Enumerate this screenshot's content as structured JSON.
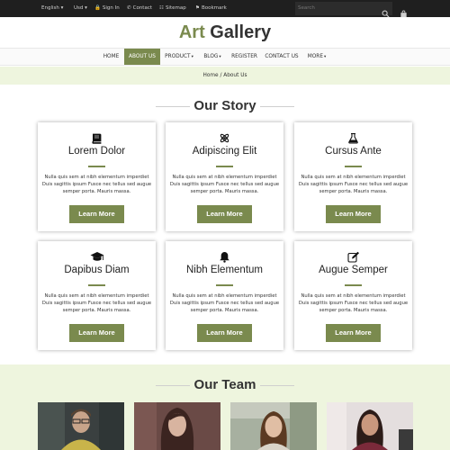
{
  "topbar": {
    "language": "English",
    "currency": "Usd",
    "signin": "Sign In",
    "contact": "Contact",
    "sitemap": "Sitemap",
    "bookmark": "Bookmark",
    "search_placeholder": "Search"
  },
  "brand": {
    "part1": "Art",
    "part2": " Gallery",
    "accent_color": "#7a8a4e"
  },
  "nav": {
    "items": [
      {
        "label": "HOME",
        "dropdown": false
      },
      {
        "label": "ABOUT US",
        "dropdown": false,
        "active": true
      },
      {
        "label": "PRODUCT",
        "dropdown": true
      },
      {
        "label": "BLOG",
        "dropdown": true
      },
      {
        "label": "REGISTER",
        "dropdown": false
      },
      {
        "label": "CONTACT US",
        "dropdown": false
      },
      {
        "label": "MORE",
        "dropdown": true
      }
    ]
  },
  "breadcrumb": "Home / About Us",
  "story": {
    "heading": "Our Story",
    "cards": [
      {
        "icon": "book-icon",
        "title": "Lorem Dolor",
        "text": "Nulla quis sem at nibh elementum imperdiet Duis sagittis ipsum Fusce nec tellus sed augue semper porta. Mauris massa.",
        "button": "Learn More"
      },
      {
        "icon": "atom-icon",
        "title": "Adipiscing Elit",
        "text": "Nulla quis sem at nibh elementum imperdiet Duis sagittis ipsum Fusce nec tellus sed augue semper porta. Mauris massa.",
        "button": "Learn More"
      },
      {
        "icon": "flask-icon",
        "title": "Cursus Ante",
        "text": "Nulla quis sem at nibh elementum imperdiet Duis sagittis ipsum Fusce nec tellus sed augue semper porta. Mauris massa.",
        "button": "Learn More"
      },
      {
        "icon": "graduation-cap-icon",
        "title": "Dapibus Diam",
        "text": "Nulla quis sem at nibh elementum imperdiet Duis sagittis ipsum Fusce nec tellus sed augue semper porta. Mauris massa.",
        "button": "Learn More"
      },
      {
        "icon": "bell-icon",
        "title": "Nibh Elementum",
        "text": "Nulla quis sem at nibh elementum imperdiet Duis sagittis ipsum Fusce nec tellus sed augue semper porta. Mauris massa.",
        "button": "Learn More"
      },
      {
        "icon": "edit-icon",
        "title": "Augue Semper",
        "text": "Nulla quis sem at nibh elementum imperdiet Duis sagittis ipsum Fusce nec tellus sed augue semper porta. Mauris massa.",
        "button": "Learn More"
      }
    ]
  },
  "team": {
    "heading": "Our Team"
  }
}
